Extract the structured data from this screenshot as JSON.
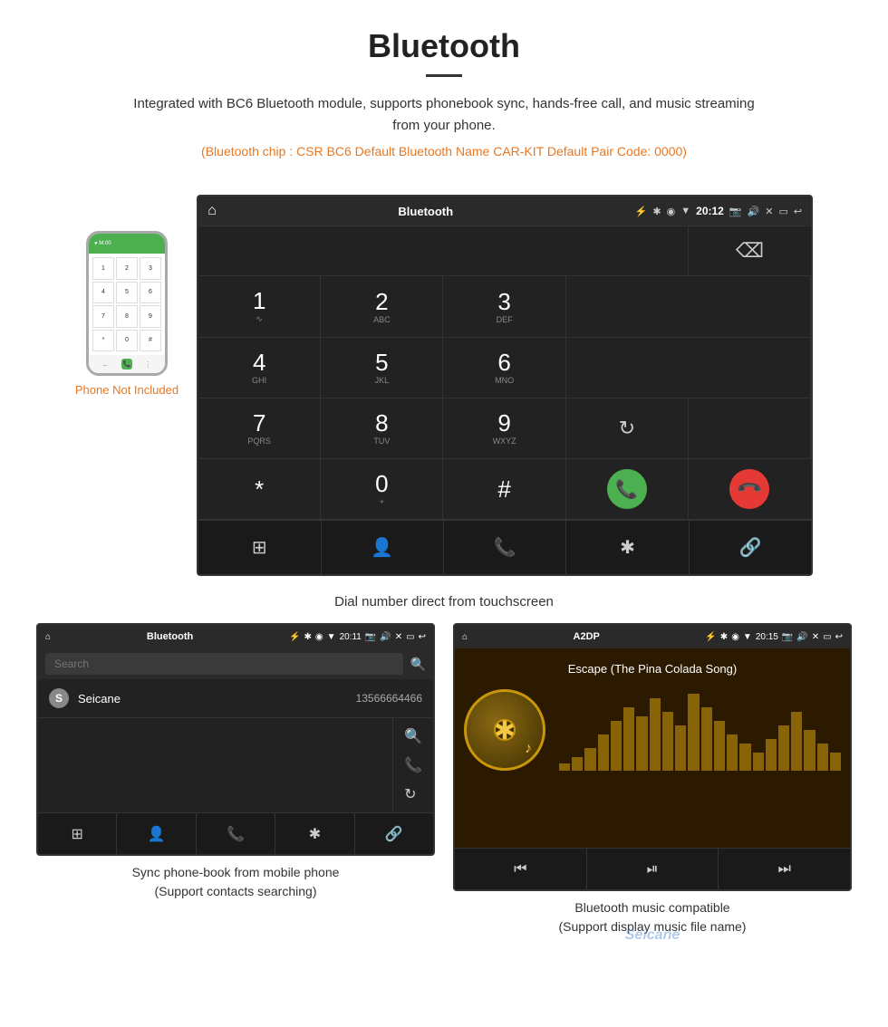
{
  "header": {
    "title": "Bluetooth",
    "description": "Integrated with BC6 Bluetooth module, supports phonebook sync, hands-free call, and music streaming from your phone.",
    "specs": "(Bluetooth chip : CSR BC6    Default Bluetooth Name CAR-KIT    Default Pair Code: 0000)"
  },
  "phone_sidebar": {
    "not_included_label": "Phone Not Included"
  },
  "main_screen": {
    "status_bar": {
      "home_icon": "⌂",
      "title": "Bluetooth",
      "usb_icon": "⚡",
      "bluetooth_icon": "✱",
      "location_icon": "◉",
      "signal_icon": "▼",
      "time": "20:12",
      "camera_icon": "📷",
      "volume_icon": "🔊",
      "close_icon": "✕",
      "screen_icon": "▭",
      "back_icon": "↩"
    },
    "dialpad": {
      "keys": [
        {
          "num": "1",
          "letters": "∿"
        },
        {
          "num": "2",
          "letters": "ABC"
        },
        {
          "num": "3",
          "letters": "DEF"
        },
        {
          "num": "4",
          "letters": "GHI"
        },
        {
          "num": "5",
          "letters": "JKL"
        },
        {
          "num": "6",
          "letters": "MNO"
        },
        {
          "num": "7",
          "letters": "PQRS"
        },
        {
          "num": "8",
          "letters": "TUV"
        },
        {
          "num": "9",
          "letters": "WXYZ"
        },
        {
          "num": "*",
          "letters": ""
        },
        {
          "num": "0",
          "letters": "+"
        },
        {
          "num": "#",
          "letters": ""
        }
      ]
    },
    "bottom_nav": {
      "grid_icon": "⊞",
      "person_icon": "👤",
      "phone_icon": "📞",
      "bluetooth_icon": "✱",
      "link_icon": "🔗"
    }
  },
  "main_caption": "Dial number direct from touchscreen",
  "phonebook_screen": {
    "status_bar": {
      "home_icon": "⌂",
      "title": "Bluetooth",
      "usb_icon": "⚡",
      "bluetooth_icon": "✱",
      "location_icon": "◉",
      "signal_icon": "▼",
      "time": "20:11"
    },
    "search_placeholder": "Search",
    "contact": {
      "letter": "S",
      "name": "Seicane",
      "number": "13566664466"
    },
    "bottom_nav": {
      "grid_icon": "⊞",
      "person_icon": "👤",
      "phone_icon": "📞",
      "bluetooth_icon": "✱",
      "link_icon": "🔗"
    }
  },
  "phonebook_caption_line1": "Sync phone-book from mobile phone",
  "phonebook_caption_line2": "(Support contacts searching)",
  "music_screen": {
    "status_bar": {
      "home_icon": "⌂",
      "title": "A2DP",
      "usb_icon": "⚡",
      "bluetooth_icon": "✱",
      "location_icon": "◉",
      "signal_icon": "▼",
      "time": "20:15"
    },
    "song_title": "Escape (The Pina Colada Song)",
    "music_icon": "♪",
    "bottom_nav": {
      "prev_icon": "⏮",
      "play_icon": "⏯",
      "next_icon": "⏭"
    }
  },
  "music_caption_line1": "Bluetooth music compatible",
  "music_caption_line2": "(Support display music file name)",
  "eq_bars": [
    8,
    15,
    25,
    40,
    55,
    70,
    60,
    80,
    65,
    50,
    85,
    70,
    55,
    40,
    30,
    20,
    35,
    50,
    65,
    45,
    30,
    20
  ]
}
